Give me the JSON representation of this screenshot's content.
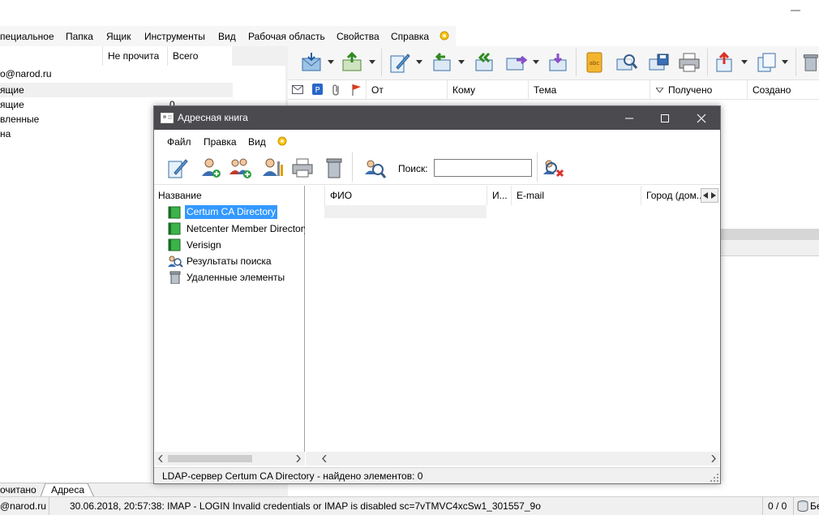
{
  "main": {
    "menu": [
      "пециальное",
      "Папка",
      "Ящик",
      "Инструменты",
      "Вид",
      "Рабочая область",
      "Свойства",
      "Справка"
    ],
    "folder_columns": {
      "unread": "Не прочита",
      "total": "Всего"
    },
    "account": "o@narod.ru",
    "folders": [
      "ящие",
      "ящие",
      "вленные",
      "на"
    ],
    "folder_counts": [
      "0"
    ],
    "message_columns": {
      "from": "От",
      "to": "Кому",
      "subject": "Тема",
      "received": "Получено",
      "created": "Создано"
    },
    "bottom_tabs": [
      "очитано",
      "Адреса"
    ]
  },
  "status": {
    "account": "@narod.ru",
    "message": "30.06.2018, 20:57:38: IMAP  - LOGIN Invalid credentials or IMAP is disabled sc=7vTMVC4xcSw1_301557_9o",
    "counter": "0 / 0",
    "extra": "Бе"
  },
  "address_book": {
    "title": "Адресная книга",
    "menu": [
      "Файл",
      "Правка",
      "Вид"
    ],
    "search_label": "Поиск:",
    "search_value": "",
    "tree_header": "Название",
    "tree_items": [
      "Certum CA Directory",
      "Netcenter Member Directory",
      "Verisign",
      "Результаты поиска",
      "Удаленные элементы"
    ],
    "list_columns": {
      "name": "ФИО",
      "initials": "И...",
      "email": "E-mail",
      "city": "Город (дом..."
    },
    "status": "LDAP-сервер Certum CA Directory - найдено элементов: 0"
  },
  "colors": {
    "titlebar": "#4a4a4f",
    "selection": "#3399ff",
    "chrome": "#f0f0f0"
  }
}
